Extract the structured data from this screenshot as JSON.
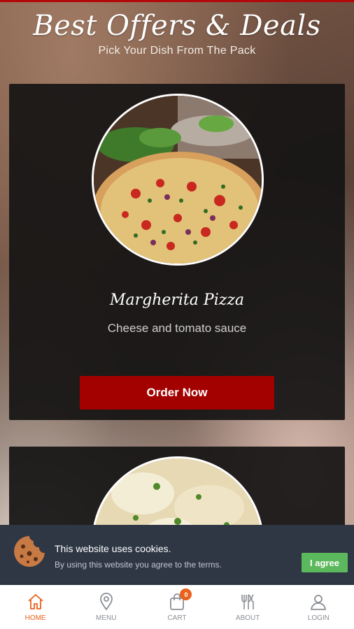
{
  "header": {
    "title": "Best Offers & Deals",
    "subtitle": "Pick Your Dish From The Pack"
  },
  "dishes": [
    {
      "name": "Margherita Pizza",
      "description": "Cheese and tomato sauce",
      "order_label": "Order Now"
    }
  ],
  "cookie_banner": {
    "title": "This website uses cookies.",
    "text": "By using this website you agree to the terms.",
    "agree_label": "I agree"
  },
  "nav": {
    "items": [
      {
        "label": "HOME",
        "icon": "home-icon",
        "active": true
      },
      {
        "label": "MENU",
        "icon": "location-pin-icon"
      },
      {
        "label": "CART",
        "icon": "shopping-bag-icon",
        "badge": "0"
      },
      {
        "label": "ABOUT",
        "icon": "cutlery-icon"
      },
      {
        "label": "LOGIN",
        "icon": "user-icon"
      }
    ]
  },
  "colors": {
    "accent": "#a30000",
    "nav_active": "#e9611c",
    "cookie_bg": "#2f3745",
    "agree_button": "#5cb85c"
  }
}
